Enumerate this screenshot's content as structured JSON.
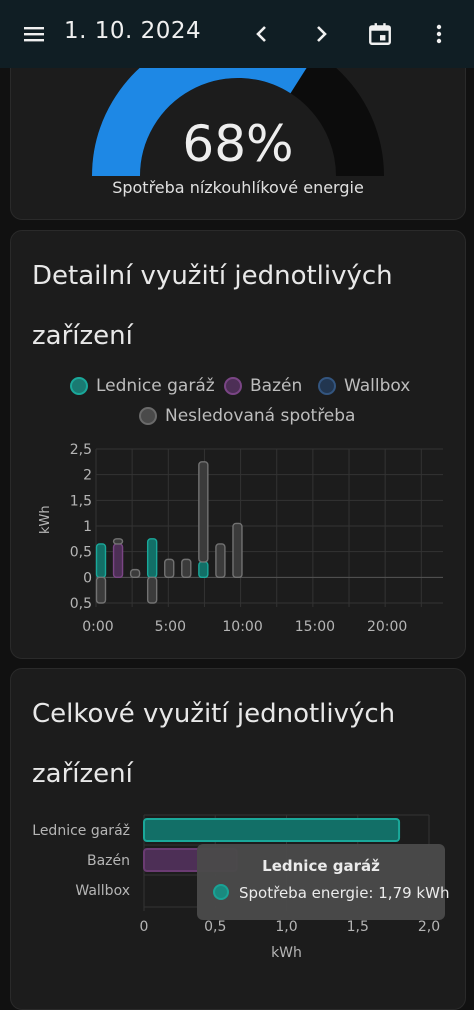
{
  "topbar": {
    "date": "1. 10. 2024",
    "icons": [
      "menu-icon",
      "chevron-left-icon",
      "chevron-right-icon",
      "calendar-icon",
      "more-vert-icon"
    ]
  },
  "gauge": {
    "value_label": "68%",
    "value": 0.68,
    "caption": "Spotřeba nízkouhlíkové energie",
    "color_fill": "#1e88e5",
    "color_track": "#0c0c0c"
  },
  "detail_card": {
    "title_line1": "Detailní využití jednotlivých",
    "title_line2": "zařízení",
    "legend": [
      {
        "label": "Lednice garáž",
        "color": "#1aa89a"
      },
      {
        "label": "Bazén",
        "color": "#6a3b72"
      },
      {
        "label": "Wallbox",
        "color": "#27405e"
      },
      {
        "label": "Nesledovaná spotřeba",
        "color": "#5a5a5a"
      }
    ]
  },
  "total_card": {
    "title_line1": "Celkové využití jednotlivých",
    "title_line2": "zařízení"
  },
  "tooltip": {
    "title": "Lednice garáž",
    "text": "Spotřeba energie: 1,79 kWh"
  },
  "chart_data": [
    {
      "type": "bar",
      "stacked": true,
      "ylabel": "kWh",
      "ylim": [
        -0.5,
        2.5
      ],
      "yticks": [
        "2,5",
        "2",
        "1,5",
        "1",
        "0,5",
        "0",
        "0,5"
      ],
      "xticks": [
        "0:00",
        "5:00",
        "10:00",
        "15:00",
        "20:00"
      ],
      "x_hours": [
        0,
        1,
        2,
        3,
        4,
        5,
        6,
        7
      ],
      "series": [
        {
          "name": "Lednice garáž",
          "color": "#1aa89a",
          "values": [
            0.65,
            0,
            0,
            0.75,
            0,
            0,
            0.3,
            0
          ]
        },
        {
          "name": "Bazén",
          "color": "#6a3b72",
          "values": [
            0,
            0.65,
            0,
            0,
            0,
            0,
            0,
            0
          ]
        },
        {
          "name": "Wallbox",
          "color": "#27405e",
          "values": [
            0,
            0,
            0,
            0,
            0,
            0,
            0,
            0
          ]
        },
        {
          "name": "Nesledovaná spotřeba",
          "color": "#5a5a5a",
          "values": [
            -0.5,
            0.1,
            0.15,
            -0.5,
            0.35,
            0.35,
            1.95,
            0.65
          ]
        },
        {
          "name": "Nesledovaná spotřeba (8:00)",
          "color": "#5a5a5a",
          "values_extra": {
            "8": 1.05
          }
        }
      ],
      "grid": true
    },
    {
      "type": "bar",
      "orientation": "horizontal",
      "xlabel": "kWh",
      "xlim": [
        0,
        2.0
      ],
      "xticks": [
        "0",
        "0,5",
        "1,0",
        "1,5",
        "2,0"
      ],
      "categories": [
        "Lednice garáž",
        "Bazén",
        "Wallbox"
      ],
      "values": [
        1.79,
        0.65,
        0
      ],
      "colors": [
        "#1aa89a",
        "#6a3b72",
        "#27405e"
      ],
      "grid": true
    }
  ]
}
